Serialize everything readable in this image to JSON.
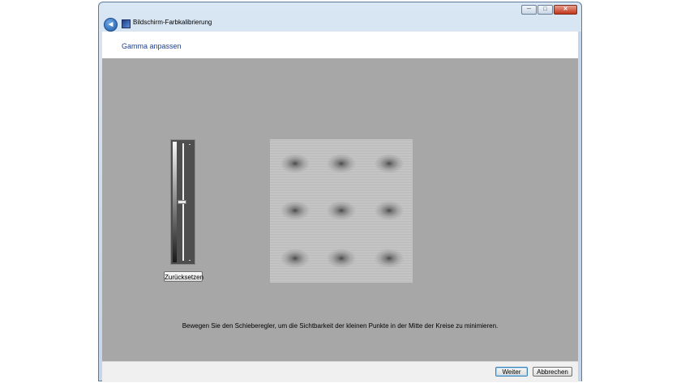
{
  "window": {
    "title": "Bildschirm-Farbkalibrierung",
    "back_symbol": "◄",
    "caption": {
      "minimize": "─",
      "maximize": "□",
      "close": "✕"
    }
  },
  "page": {
    "heading": "Gamma anpassen",
    "instruction": "Bewegen Sie den Schieberegler, um die Sichtbarkeit der kleinen Punkte in der Mitte der Kreise zu minimieren."
  },
  "gamma_slider": {
    "level": 0.5,
    "reset_label": "Zurücksetzen"
  },
  "footer": {
    "next_label": "Weiter",
    "cancel_label": "Abbrechen"
  },
  "icons": [
    "back-arrow-icon",
    "display-calibration-icon",
    "minimize-icon",
    "maximize-icon",
    "close-icon"
  ]
}
